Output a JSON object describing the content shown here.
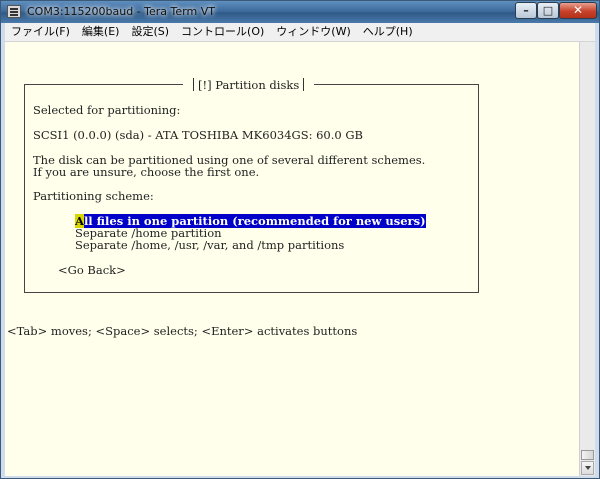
{
  "window": {
    "title": "COM3:115200baud - Tera Term VT",
    "controls": {
      "minimize": "–",
      "maximize": "□",
      "close": "✕"
    }
  },
  "menu": [
    "ファイル(F)",
    "編集(E)",
    "設定(S)",
    "コントロール(O)",
    "ウィンドウ(W)",
    "ヘルプ(H)"
  ],
  "dialog": {
    "title": "[!] Partition disks",
    "selected_label": "Selected for partitioning:",
    "disk": "SCSI1 (0.0.0) (sda) - ATA TOSHIBA MK6034GS: 60.0 GB",
    "desc_line1": "The disk can be partitioned using one of several different schemes.",
    "desc_line2": "If you are unsure, choose the first one.",
    "scheme_label": "Partitioning scheme:",
    "options": [
      {
        "first": "A",
        "rest": "ll files in one partition (recommended for new users)"
      },
      {
        "text": "Separate /home partition"
      },
      {
        "text": "Separate /home, /usr, /var, and /tmp partitions"
      }
    ],
    "go_back": "<Go Back>"
  },
  "help_line": "<Tab> moves; <Space> selects; <Enter> activates buttons",
  "colors": {
    "terminal_bg": "#ffffec",
    "selection_bg": "#0000c8",
    "cursor_bg": "#d8d800"
  },
  "icons": {
    "app": "terminal-icon",
    "scroll": "chevron-down-icon"
  }
}
